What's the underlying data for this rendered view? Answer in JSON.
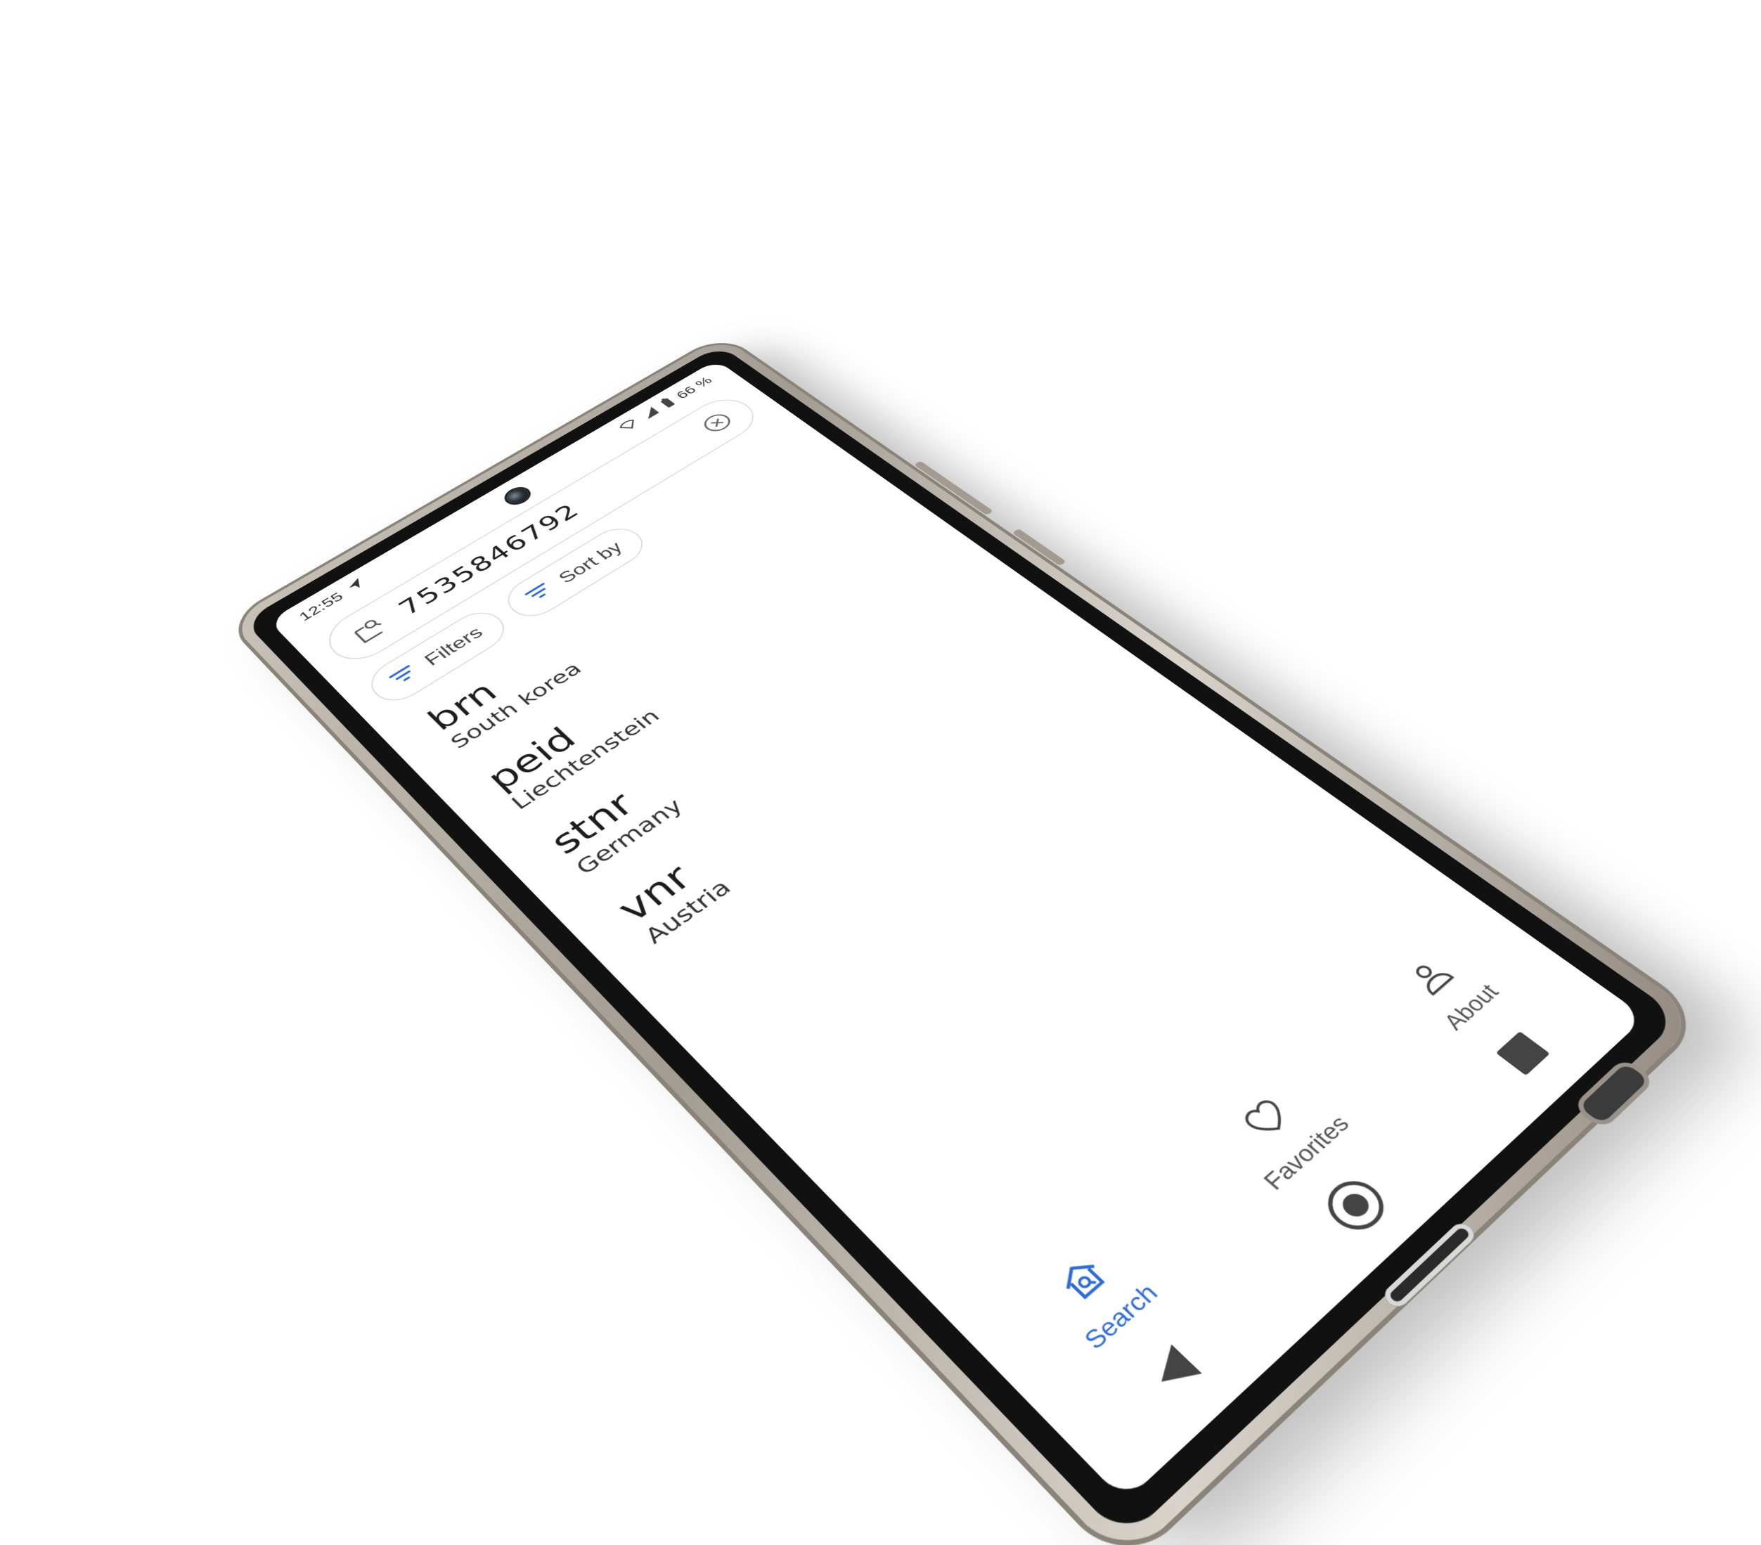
{
  "status_bar": {
    "time": "12:55",
    "battery": "66 %"
  },
  "search": {
    "value": "7535846792"
  },
  "chips": [
    {
      "label": "Filters"
    },
    {
      "label": "Sort by"
    }
  ],
  "results": [
    {
      "title": "brn",
      "subtitle": "South korea"
    },
    {
      "title": "peid",
      "subtitle": "Liechtenstein"
    },
    {
      "title": "stnr",
      "subtitle": "Germany"
    },
    {
      "title": "vnr",
      "subtitle": "Austria"
    }
  ],
  "bottom_nav": [
    {
      "label": "Search",
      "icon": "home-search-icon",
      "active": true
    },
    {
      "label": "Favorites",
      "icon": "heart-icon",
      "active": false
    },
    {
      "label": "About",
      "icon": "person-icon",
      "active": false
    }
  ],
  "colors": {
    "accent": "#2f6bd6",
    "text": "#1c1c1c"
  }
}
